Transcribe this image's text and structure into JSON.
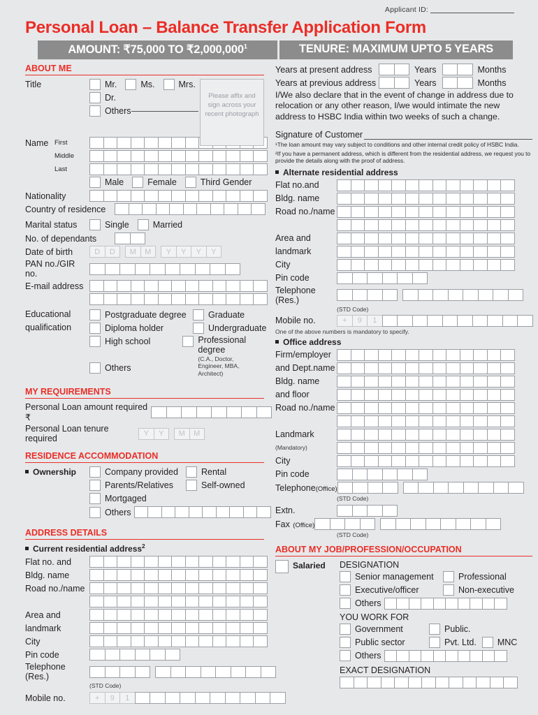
{
  "header": {
    "applicant_id_label": "Applicant ID:",
    "title": "Personal Loan – Balance Transfer Application Form",
    "band_amount": "AMOUNT: ₹75,000 TO ₹2,000,000",
    "band_amount_sup": "1",
    "band_tenure": "TENURE: MAXIMUM UPTO 5 YEARS"
  },
  "about_me": {
    "heading": "ABOUT ME",
    "title_label": "Title",
    "titles_row1": [
      "Mr.",
      "Ms.",
      "Mrs."
    ],
    "title_dr": "Dr.",
    "title_others": "Others",
    "photo_text": "Please affix and sign across your recent photograph",
    "name_label": "Name",
    "name_rows": [
      {
        "sub": "First",
        "cells": 13
      },
      {
        "sub": "Middle",
        "cells": 13
      },
      {
        "sub": "Last",
        "cells": 13
      }
    ],
    "genders": [
      "Male",
      "Female",
      "Third Gender"
    ],
    "nationality_label": "Nationality",
    "nationality_cells": 13,
    "country_label": "Country of residence",
    "country_cells": 11,
    "marital_label": "Marital status",
    "marital_options": [
      "Single",
      "Married"
    ],
    "dependants_label": "No. of dependants",
    "dependants_cells": 2,
    "dob_label": "Date of birth",
    "dob_groups": [
      [
        "D",
        "D"
      ],
      [
        "M",
        "M"
      ],
      [
        "Y",
        "Y",
        "Y",
        "Y"
      ]
    ],
    "pan_label": "PAN no./GIR no.",
    "pan_cells": 10,
    "email_label": "E-mail address",
    "email_rows": [
      13,
      13
    ],
    "edu_label_line1": "Educational",
    "edu_label_line2": "qualification",
    "edu_left": [
      "Postgraduate degree",
      "Diploma holder",
      "High school",
      "Others"
    ],
    "edu_right": [
      "Graduate",
      "Undergraduate",
      "Professional degree"
    ],
    "edu_prof_note": "(C.A., Doctor, Engineer, MBA, Architect)"
  },
  "my_requirements": {
    "heading": "MY REQUIREMENTS",
    "amount_label": "Personal Loan amount required ₹",
    "amount_cells": 8,
    "tenure_label": "Personal Loan tenure required",
    "tenure_groups": [
      [
        "Y",
        "Y"
      ],
      [
        "M",
        "M"
      ]
    ]
  },
  "residence_accommodation": {
    "heading": "RESIDENCE ACCOMMODATION",
    "ownership_label": "Ownership",
    "left_options": [
      "Company provided",
      "Parents/Relatives",
      "Mortgaged"
    ],
    "right_options": [
      "Rental",
      "Self-owned"
    ],
    "others_label": "Others",
    "others_cells": 10
  },
  "address_details": {
    "heading": "ADDRESS DETAILS",
    "current_sub": "Current residential address",
    "current_sub_sup": "2",
    "rows": [
      {
        "label": "Flat no. and",
        "cells": 13
      },
      {
        "label": "Bldg. name",
        "cells": 13
      },
      {
        "label": "Road no./name",
        "cells": 13
      },
      {
        "label": "",
        "cells": 13
      },
      {
        "label": "Area and",
        "cells": 13
      },
      {
        "label": "landmark",
        "cells": 13
      },
      {
        "label": "City",
        "cells": 13
      }
    ],
    "pin_label": "Pin code",
    "pin_cells": 6,
    "tel_label": "Telephone (Res.)",
    "tel_std_cells": 4,
    "tel_num_cells": 8,
    "std_note": "(STD Code)",
    "mobile_label": "Mobile no.",
    "mobile_prefix": [
      "+",
      "9",
      "1"
    ],
    "mobile_cells": 10
  },
  "right": {
    "years_present_label": "Years at present address",
    "years_previous_label": "Years at previous address",
    "years_word": "Years",
    "months_word": "Months",
    "declaration": "I/We also declare that in the event of change in address due to relocation or any other reason, I/we would intimate the new address to HSBC India within two weeks of such a change.",
    "signature_label": "Signature of Customer",
    "footnote1": "¹The loan amount may vary subject to conditions and other internal credit policy of HSBC India.",
    "footnote2": "²If you have a permanent address, which is different from the residential address, we request you to provide the details along with the proof of address.",
    "alternate_sub": "Alternate residential address",
    "alternate_rows": [
      {
        "label": "Flat no.and",
        "cells": 13
      },
      {
        "label": "Bldg. name",
        "cells": 13
      },
      {
        "label": "Road no./name",
        "cells": 13
      },
      {
        "label": "",
        "cells": 13
      },
      {
        "label": "Area and",
        "cells": 13
      },
      {
        "label": "landmark",
        "cells": 13
      },
      {
        "label": "City",
        "cells": 13
      }
    ],
    "alt_pin_label": "Pin code",
    "alt_pin_cells": 6,
    "alt_tel_label": "Telephone (Res.)",
    "alt_tel_std_cells": 4,
    "alt_tel_num_cells": 8,
    "std_note": "(STD Code)",
    "alt_mobile_label": "Mobile no.",
    "alt_mobile_prefix": [
      "+",
      "9",
      "1"
    ],
    "alt_mobile_cells": 10,
    "mobile_mandatory_note": "One of the above numbers is mandatory to specify.",
    "office_sub": "Office address",
    "office_rows": [
      {
        "label": "Firm/employer",
        "cells": 13
      },
      {
        "label": "and Dept.name",
        "cells": 13
      },
      {
        "label": "Bldg. name",
        "cells": 13
      },
      {
        "label": "and floor",
        "cells": 13
      },
      {
        "label": "Road no./name",
        "cells": 13
      },
      {
        "label": "",
        "cells": 13
      },
      {
        "label": "Landmark",
        "cells": 13
      }
    ],
    "landmark_note": "(Mandatory)",
    "landmark_note_cells": 13,
    "office_city_label": "City",
    "office_city_cells": 13,
    "office_pin_label": "Pin code",
    "office_pin_cells": 6,
    "office_tel_label": "Telephone",
    "office_tel_sub": "(Office)",
    "office_tel_std_cells": 4,
    "office_tel_num_cells": 8,
    "extn_label": "Extn.",
    "extn_cells": 4,
    "fax_label": "Fax",
    "fax_sub": "(Office)",
    "fax_std_cells": 4,
    "fax_num_cells": 8
  },
  "job": {
    "heading": "ABOUT MY JOB/PROFESSION/OCCUPATION",
    "salaried_label": "Salaried",
    "designation_label": "DESIGNATION",
    "designation_left": [
      "Senior management",
      "Executive/officer"
    ],
    "designation_right": [
      "Professional",
      "Non-executive"
    ],
    "designation_others": "Others",
    "designation_others_cells": 10,
    "work_for_label": "YOU WORK FOR",
    "work_row1": [
      "Government",
      "Public."
    ],
    "work_row2": [
      "Public sector",
      "Pvt. Ltd.",
      "MNC"
    ],
    "work_others": "Others",
    "work_others_cells": 10,
    "exact_designation_label": "EXACT DESIGNATION",
    "exact_designation_cells": 13
  },
  "colors": {
    "accent": "#ea2e26",
    "band": "#8c8c8c",
    "background": "#e7e8ea"
  }
}
